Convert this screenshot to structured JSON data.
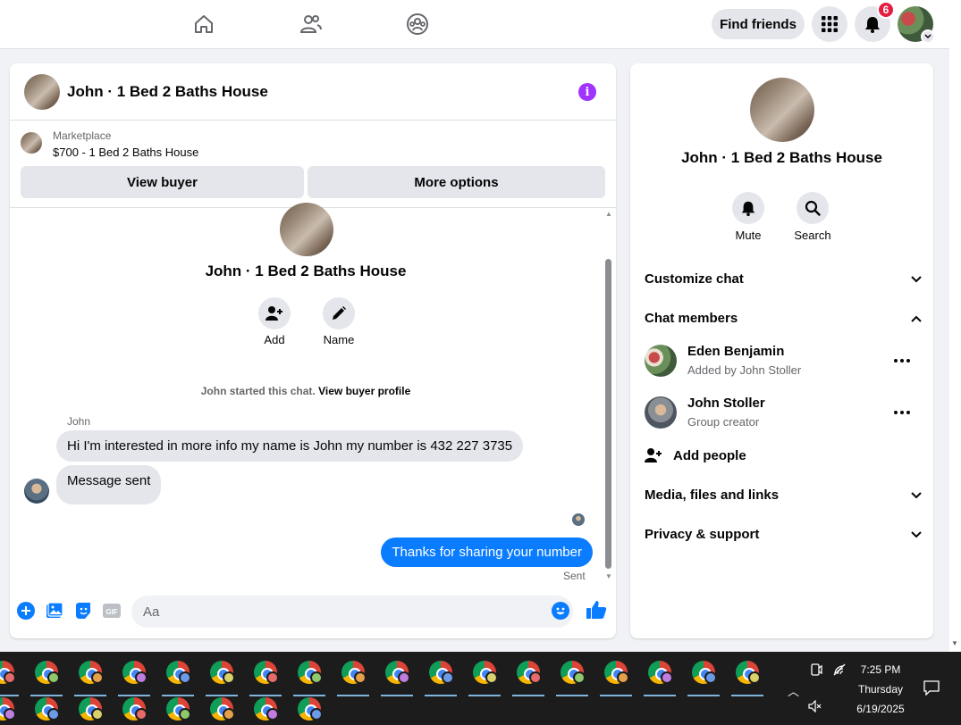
{
  "topnav": {
    "find_friends": "Find friends",
    "notification_count": "6"
  },
  "chat": {
    "header_title": "John · 1 Bed 2 Baths House",
    "marketplace_label": "Marketplace",
    "listing": "$700 - 1 Bed 2 Baths House",
    "view_buyer": "View buyer",
    "more_options": "More options",
    "center_title": "John · 1 Bed 2 Baths House",
    "add_label": "Add",
    "name_label": "Name",
    "started_text": "John started this chat.",
    "view_buyer_profile": "View buyer profile",
    "sender_name": "John",
    "message_in_1": "Hi I'm interested in more info my name is John my number is 432 227 3735",
    "message_in_2": "Message sent",
    "message_out": "Thanks for sharing your number",
    "sent_status": "Sent",
    "input_placeholder": "Aa"
  },
  "details": {
    "title": "John · 1 Bed 2 Baths House",
    "mute": "Mute",
    "search": "Search",
    "customize_chat": "Customize chat",
    "chat_members": "Chat members",
    "members": [
      {
        "name": "Eden Benjamin",
        "sub": "Added by John Stoller"
      },
      {
        "name": "John Stoller",
        "sub": "Group creator"
      }
    ],
    "add_people": "Add people",
    "media_files_links": "Media, files and links",
    "privacy_support": "Privacy & support"
  },
  "taskbar": {
    "time": "7:25 PM",
    "day": "Thursday",
    "date": "6/19/2025"
  },
  "colors": {
    "accent_blue": "#0a7cff",
    "info_purple": "#a033ff",
    "badge_red": "#e41e3f"
  }
}
